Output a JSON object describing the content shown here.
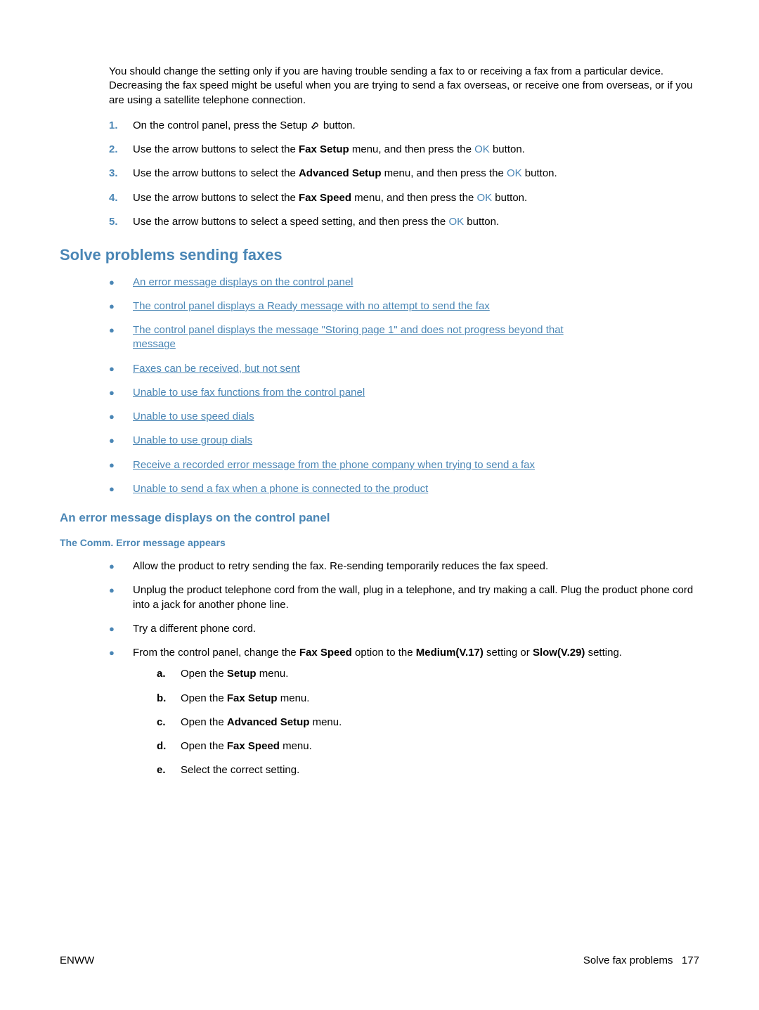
{
  "intro": "You should change the setting only if you are having trouble sending a fax to or receiving a fax from a particular device. Decreasing the fax speed might be useful when you are trying to send a fax overseas, or receive one from overseas, or if you are using a satellite telephone connection.",
  "steps": {
    "s1": {
      "num": "1.",
      "part1": "On the control panel, press the Setup ",
      "part2": " button."
    },
    "s2": {
      "num": "2.",
      "part1": "Use the arrow buttons to select the ",
      "bold": "Fax Setup",
      "part2": " menu, and then press the ",
      "ok": "OK",
      "part3": " button."
    },
    "s3": {
      "num": "3.",
      "part1": "Use the arrow buttons to select the ",
      "bold": "Advanced Setup",
      "part2": " menu, and then press the ",
      "ok": "OK",
      "part3": " button."
    },
    "s4": {
      "num": "4.",
      "part1": "Use the arrow buttons to select the ",
      "bold": "Fax Speed",
      "part2": " menu, and then press the ",
      "ok": "OK",
      "part3": " button."
    },
    "s5": {
      "num": "5.",
      "part1": "Use the arrow buttons to select a speed setting, and then press the ",
      "ok": "OK",
      "part2": " button."
    }
  },
  "section_title": "Solve problems sending faxes",
  "links": {
    "l1": "An error message displays on the control panel",
    "l2": "The control panel displays a Ready message with no attempt to send the fax",
    "l3a": "The control panel displays the message \"Storing page 1\" and does not progress beyond that",
    "l3b": "message",
    "l4": "Faxes can be received, but not sent",
    "l5": "Unable to use fax functions from the control panel",
    "l6": "Unable to use speed dials",
    "l7": "Unable to use group dials",
    "l8": "Receive a recorded error message from the phone company when trying to send a fax",
    "l9": "Unable to send a fax when a phone is connected to the product"
  },
  "sub1": "An error message displays on the control panel",
  "sub2": "The Comm. Error message appears",
  "bullets2": {
    "b1": "Allow the product to retry sending the fax. Re-sending temporarily reduces the fax speed.",
    "b2": "Unplug the product telephone cord from the wall, plug in a telephone, and try making a call. Plug the product phone cord into a jack for another phone line.",
    "b3": "Try a different phone cord.",
    "b4": {
      "part1": "From the control panel, change the ",
      "bold1": "Fax Speed",
      "part2": " option to the ",
      "bold2": "Medium(V.17)",
      "part3": " setting or ",
      "bold3": "Slow(V.29)",
      "part4": " setting."
    }
  },
  "sublist": {
    "a": {
      "lett": "a.",
      "part1": "Open the ",
      "bold": "Setup",
      "part2": " menu."
    },
    "b": {
      "lett": "b.",
      "part1": "Open the ",
      "bold": "Fax Setup",
      "part2": " menu."
    },
    "c": {
      "lett": "c.",
      "part1": "Open the ",
      "bold": "Advanced Setup",
      "part2": " menu."
    },
    "d": {
      "lett": "d.",
      "part1": "Open the ",
      "bold": "Fax Speed",
      "part2": " menu."
    },
    "e": {
      "lett": "e.",
      "txt": "Select the correct setting."
    }
  },
  "footer": {
    "left": "ENWW",
    "right_text": "Solve fax problems",
    "right_page": "177"
  }
}
